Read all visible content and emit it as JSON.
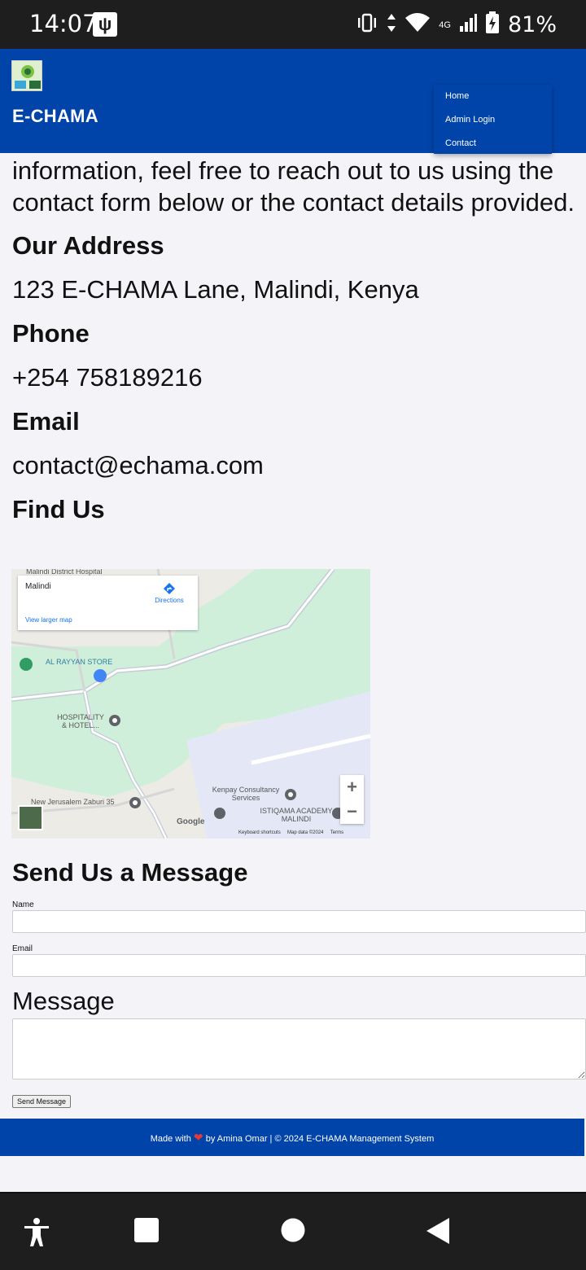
{
  "status_bar": {
    "time": "14:07",
    "network": "4G",
    "battery": "81%"
  },
  "header": {
    "brand": "E-CHAMA",
    "logo_icon": "echama-logo-icon",
    "menu": [
      "Home",
      "Admin Login",
      "Contact"
    ]
  },
  "intro_text": "information, feel free to reach out to us using the contact form below or the contact details provided.",
  "address": {
    "heading": "Our Address",
    "value": "123 E-CHAMA Lane, Malindi, Kenya"
  },
  "phone": {
    "heading": "Phone",
    "value": "+254 758189216"
  },
  "email": {
    "heading": "Email",
    "value": "contact@echama.com"
  },
  "find_us": {
    "heading": "Find Us"
  },
  "map": {
    "place": "Malindi",
    "directions": "Directions",
    "larger_map": "View larger map",
    "labels": {
      "hospital": "Malindi District Hospital",
      "store": "AL RAYYAN STORE",
      "hotel": "HOSPITALITY & HOTEL...",
      "jerusalem": "New Jerusalem Zaburi 35",
      "kenpay": "Kenpay Consultancy Services",
      "academy": "ISTIQAMA ACADEMY MALINDI"
    },
    "google": "Google",
    "shortcuts": "Keyboard shortcuts",
    "map_data": "Map data ©2024",
    "terms": "Terms",
    "zoom_in": "+",
    "zoom_out": "−"
  },
  "form": {
    "title": "Send Us a Message",
    "name_label": "Name",
    "email_label": "Email",
    "message_label": "Message",
    "name_value": "",
    "email_value": "",
    "message_value": "",
    "submit": "Send Message"
  },
  "footer": {
    "made_with": "Made with",
    "by_text": "by Amina Omar | © 2024 E-CHAMA Management System"
  },
  "colors": {
    "primary": "#0044aa",
    "page_bg": "#f4f4f8",
    "heart": "#e53935"
  }
}
